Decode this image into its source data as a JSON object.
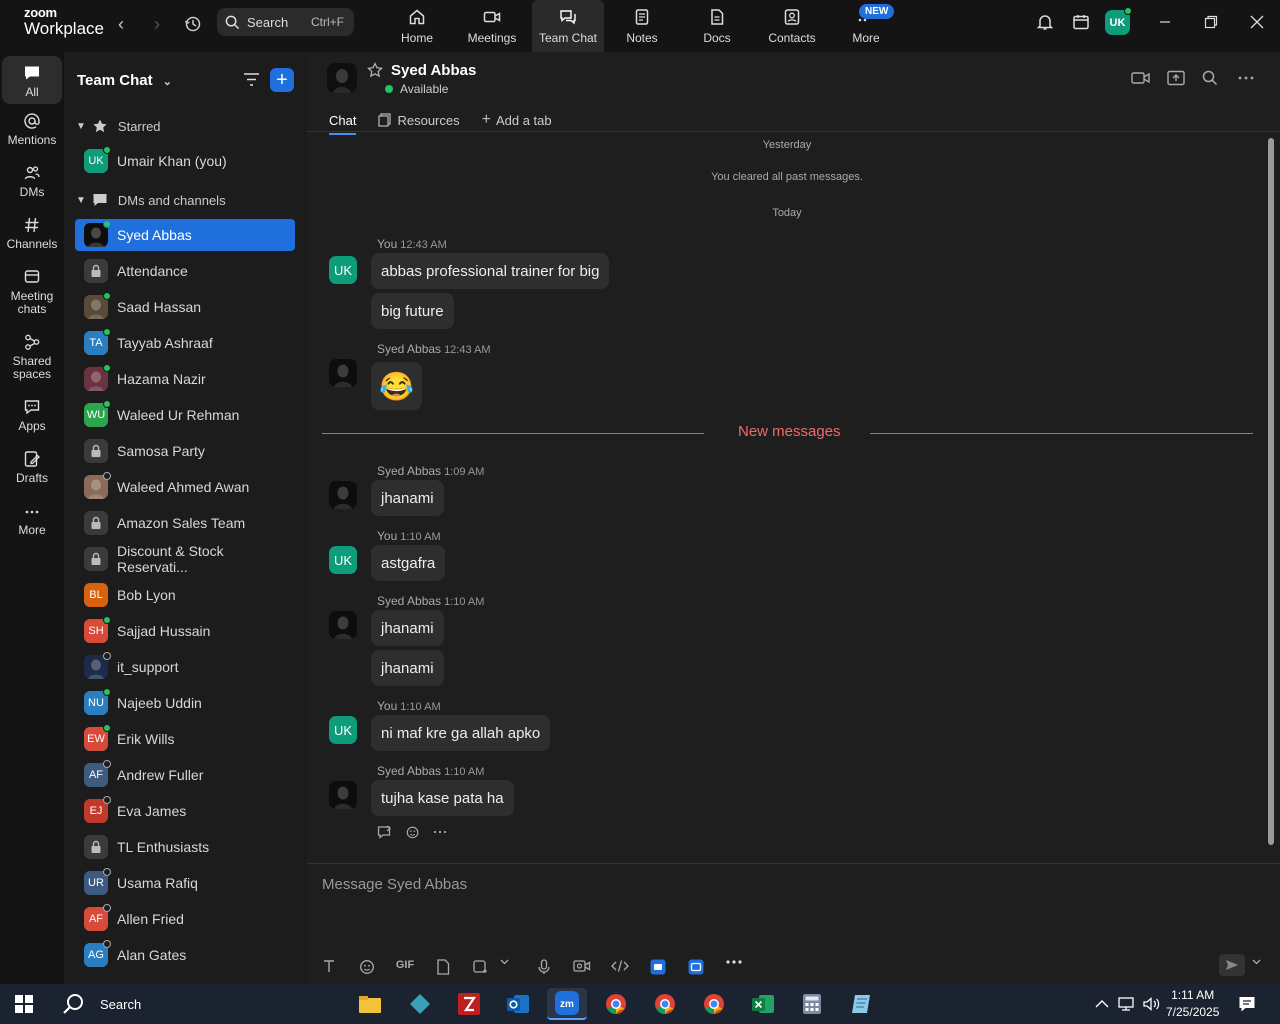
{
  "app": {
    "logo_line1": "zoom",
    "logo_line2": "Workplace"
  },
  "search": {
    "label": "Search",
    "shortcut": "Ctrl+F"
  },
  "top_tabs": [
    {
      "label": "Home",
      "icon": "home-icon"
    },
    {
      "label": "Meetings",
      "icon": "video-icon"
    },
    {
      "label": "Team Chat",
      "icon": "chat-icon"
    },
    {
      "label": "Notes",
      "icon": "notes-icon"
    },
    {
      "label": "Docs",
      "icon": "docs-icon"
    },
    {
      "label": "Contacts",
      "icon": "contacts-icon"
    },
    {
      "label": "More",
      "icon": "more-icon"
    }
  ],
  "new_badge": "NEW",
  "user_initials": "UK",
  "rail": [
    {
      "label": "All"
    },
    {
      "label": "Mentions"
    },
    {
      "label": "DMs"
    },
    {
      "label": "Channels"
    },
    {
      "label": "Meeting chats"
    },
    {
      "label": "Shared spaces"
    },
    {
      "label": "Apps"
    },
    {
      "label": "Drafts"
    },
    {
      "label": "More"
    }
  ],
  "sidebar": {
    "title": "Team Chat",
    "starred_label": "Starred",
    "dms_label": "DMs and channels",
    "starred": [
      {
        "name": "Umair Khan (you)",
        "initials": "UK",
        "color": "#0e9c7a",
        "status": "on"
      }
    ],
    "items": [
      {
        "name": "Syed Abbas",
        "initials": "",
        "color": "#0d0d0d",
        "status": "on",
        "active": true
      },
      {
        "name": "Attendance",
        "initials": "",
        "color": "#3a3a3a",
        "status": "lock"
      },
      {
        "name": "Saad Hassan",
        "initials": "",
        "color": "#5a4a3a",
        "status": "on"
      },
      {
        "name": "Tayyab Ashraaf",
        "initials": "TA",
        "color": "#2b7fc1",
        "status": "on"
      },
      {
        "name": "Hazama Nazir",
        "initials": "",
        "color": "#6b3340",
        "status": "on"
      },
      {
        "name": "Waleed Ur Rehman",
        "initials": "WU",
        "color": "#2da44e",
        "status": "on"
      },
      {
        "name": "Samosa Party",
        "initials": "",
        "color": "#3a3a3a",
        "status": "lock"
      },
      {
        "name": "Waleed Ahmed Awan",
        "initials": "",
        "color": "#8a6a5a",
        "status": "off"
      },
      {
        "name": "Amazon Sales Team",
        "initials": "",
        "color": "#3a3a3a",
        "status": "lock"
      },
      {
        "name": "Discount & Stock Reservati...",
        "initials": "",
        "color": "#3a3a3a",
        "status": "lock"
      },
      {
        "name": "Bob Lyon",
        "initials": "BL",
        "color": "#d9620f",
        "status": "none"
      },
      {
        "name": "Sajjad Hussain",
        "initials": "SH",
        "color": "#d84a3a",
        "status": "on"
      },
      {
        "name": "it_support",
        "initials": "",
        "color": "#1c2b4a",
        "status": "off"
      },
      {
        "name": "Najeeb Uddin",
        "initials": "NU",
        "color": "#2b7fc1",
        "status": "on"
      },
      {
        "name": "Erik Wills",
        "initials": "EW",
        "color": "#d84a3a",
        "status": "on"
      },
      {
        "name": "Andrew Fuller",
        "initials": "AF",
        "color": "#3d5a80",
        "status": "off"
      },
      {
        "name": "Eva James",
        "initials": "EJ",
        "color": "#c0392b",
        "status": "off"
      },
      {
        "name": "TL Enthusiasts",
        "initials": "",
        "color": "#3a3a3a",
        "status": "lock"
      },
      {
        "name": "Usama Rafiq",
        "initials": "UR",
        "color": "#3d5a80",
        "status": "off"
      },
      {
        "name": "Allen Fried",
        "initials": "AF",
        "color": "#d84a3a",
        "status": "off"
      },
      {
        "name": "Alan Gates",
        "initials": "AG",
        "color": "#2b7fc1",
        "status": "off"
      }
    ]
  },
  "chat": {
    "contact_name": "Syed Abbas",
    "contact_status": "Available",
    "tabs": [
      {
        "label": "Chat"
      },
      {
        "label": "Resources"
      },
      {
        "label": "Add a tab"
      }
    ],
    "sys": {
      "yesterday": "Yesterday",
      "cleared": "You cleared all past messages.",
      "today": "Today"
    },
    "new_messages_label": "New messages",
    "messages": [
      {
        "sender": "You",
        "time": "12:43 AM",
        "av": "UK",
        "bubbles": [
          "abbas professional trainer for big",
          "big future"
        ]
      },
      {
        "sender": "Syed Abbas",
        "time": "12:43 AM",
        "av": "",
        "bubbles": [
          "😂"
        ]
      },
      {
        "sender": "Syed Abbas",
        "time": "1:09 AM",
        "av": "",
        "bubbles": [
          "jhanami"
        ]
      },
      {
        "sender": "You",
        "time": "1:10 AM",
        "av": "UK",
        "bubbles": [
          "astgafra"
        ]
      },
      {
        "sender": "Syed Abbas",
        "time": "1:10 AM",
        "av": "",
        "bubbles": [
          "jhanami",
          "jhanami"
        ]
      },
      {
        "sender": "You",
        "time": "1:10 AM",
        "av": "UK",
        "bubbles": [
          "ni maf kre ga allah apko"
        ]
      },
      {
        "sender": "Syed Abbas",
        "time": "1:10 AM",
        "av": "",
        "bubbles": [
          "tujha kase pata ha"
        ]
      }
    ],
    "composer_placeholder": "Message Syed Abbas",
    "gif_label": "GIF"
  },
  "taskbar": {
    "search_label": "Search",
    "time": "1:11 AM",
    "date": "7/25/2025"
  }
}
